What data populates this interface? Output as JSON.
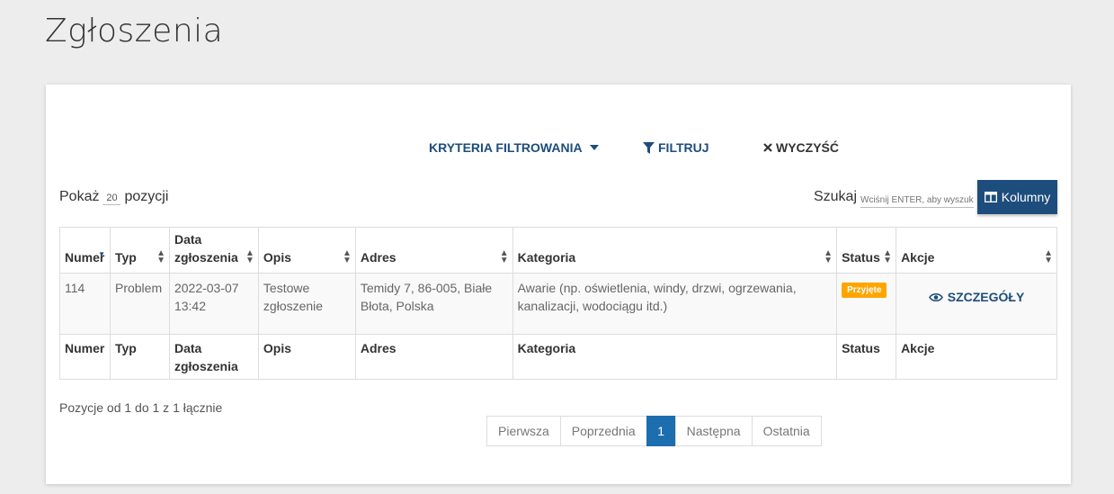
{
  "page": {
    "title": "Zgłoszenia"
  },
  "filters": {
    "criteria_label": "KRYTERIA FILTROWANIA",
    "filter_label": "FILTRUJ",
    "clear_label": "WYCZYŚĆ"
  },
  "controls": {
    "show_prefix": "Pokaż",
    "page_size": "20",
    "show_suffix": "pozycji",
    "search_label": "Szukaj",
    "search_placeholder": "Wciśnij ENTER, aby wyszukać",
    "columns_label": "Kolumny"
  },
  "table": {
    "headers": {
      "numer": "Numer",
      "typ": "Typ",
      "data_l1": "Data",
      "data_l2": "zgłoszenia",
      "opis": "Opis",
      "adres": "Adres",
      "kategoria": "Kategoria",
      "status": "Status",
      "akcje": "Akcje"
    },
    "rows": [
      {
        "numer": "114",
        "typ": "Problem",
        "data_l1": "2022-03-07",
        "data_l2": "13:42",
        "opis_l1": "Testowe",
        "opis_l2": "zgłoszenie",
        "adres_l1": "Temidy 7, 86-005, Białe",
        "adres_l2": "Błota, Polska",
        "kategoria_l1": "Awarie (np. oświetlenia, windy, drzwi, ogrzewania,",
        "kategoria_l2": "kanalizacji, wodociągu itd.)",
        "status": "Przyjęte",
        "akcja": "SZCZEGÓŁY"
      }
    ]
  },
  "summary": "Pozycje od 1 do 1 z 1 łącznie",
  "pagination": {
    "first": "Pierwsza",
    "prev": "Poprzednia",
    "current": "1",
    "next": "Następna",
    "last": "Ostatnia"
  },
  "colors": {
    "accent": "#1d4d7c",
    "active_page": "#1d6eae",
    "status_badge": "#ffa500"
  }
}
